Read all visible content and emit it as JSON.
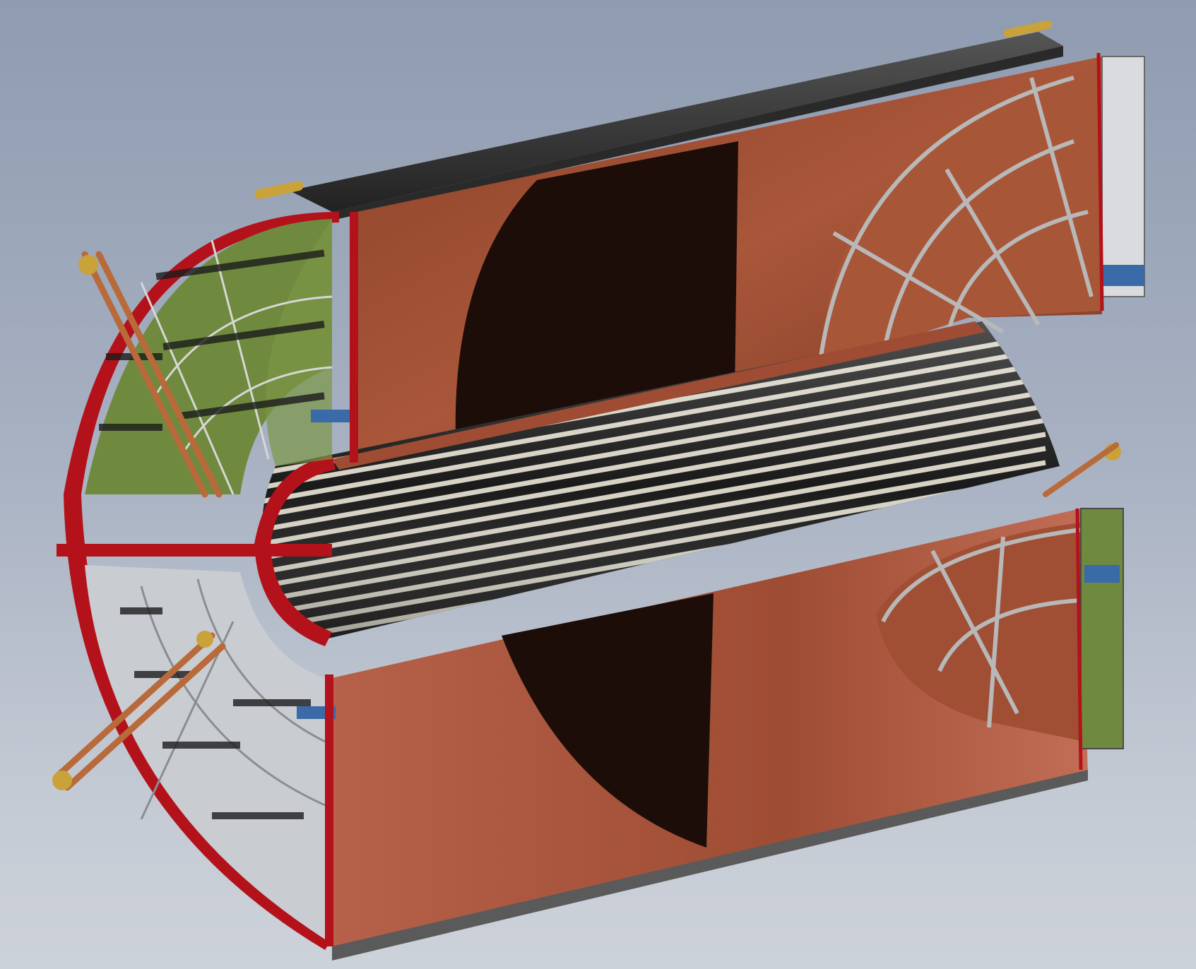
{
  "scene": {
    "subject": "tpc-detector-cutaway",
    "colors": {
      "background_top": "#8f9bb0",
      "background_bottom": "#cdd2da",
      "copper": "#b35e40",
      "copper_dark": "#7a3a24",
      "interior_dark": "#1c0d08",
      "frame_red": "#b3121a",
      "electronics_green": "#6f8a3e",
      "aluminium": "#c9ccd1",
      "dark_shell": "#2e2e2e",
      "brass_fitting": "#c9a23a",
      "field_stripe_light": "#d6d2c4",
      "field_stripe_dark": "#1a1a1a"
    },
    "icons": [
      "readout-sector-icon",
      "cooling-pipe-icon",
      "field-cage-stripe-icon"
    ]
  }
}
